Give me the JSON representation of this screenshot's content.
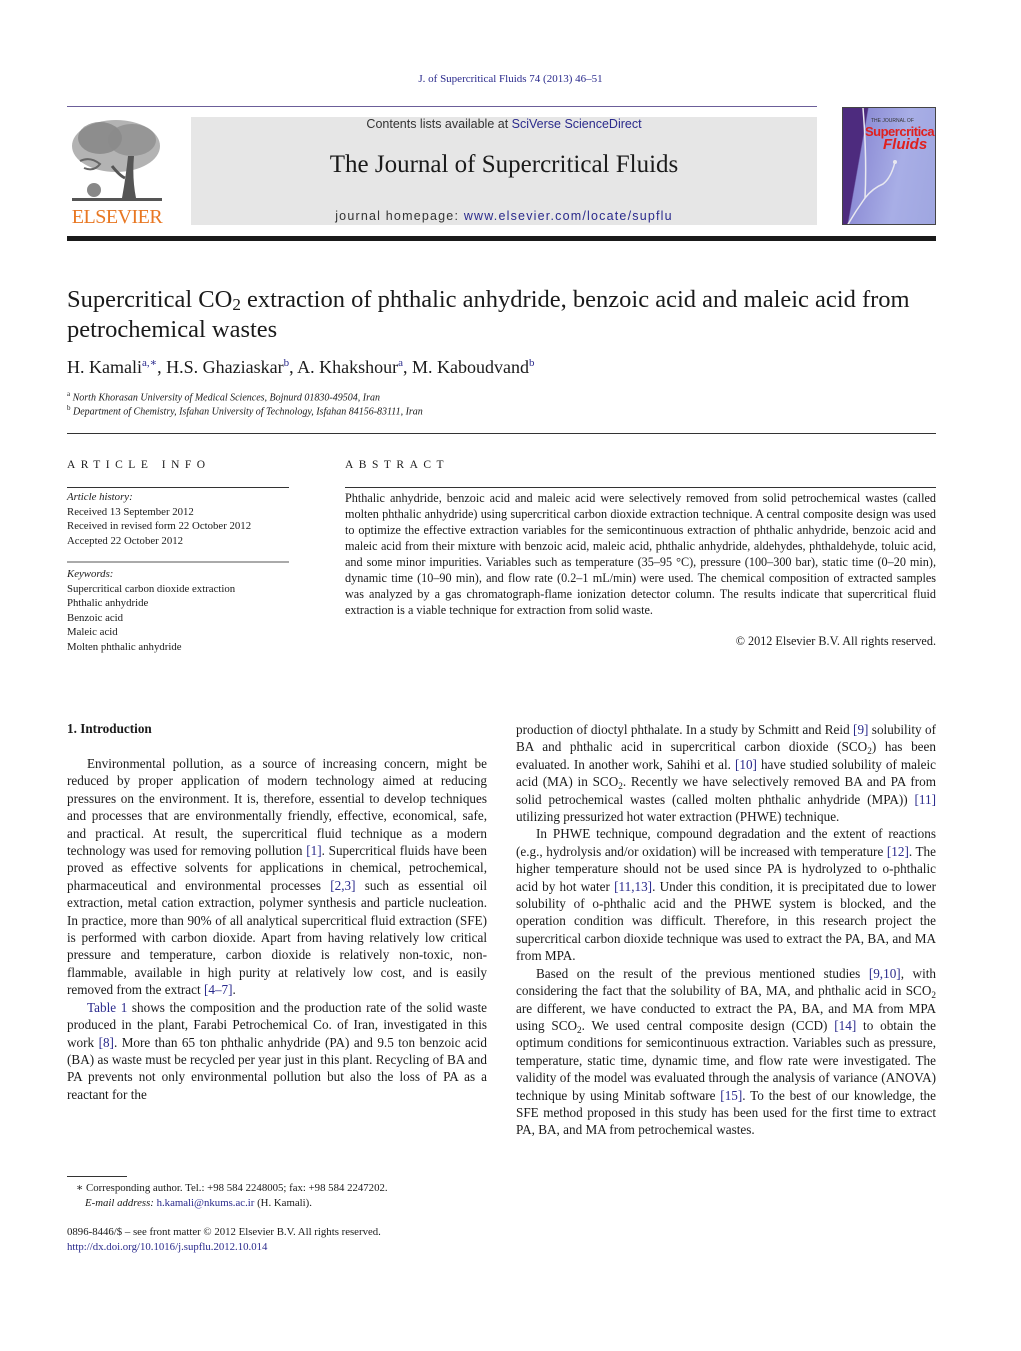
{
  "running_head": "J. of Supercritical Fluids 74 (2013) 46–51",
  "publisher": {
    "logo_text": "ELSEVIER",
    "contents_prefix": "Contents lists available at ",
    "contents_link": "SciVerse ScienceDirect",
    "journal_title": "The Journal of Supercritical Fluids",
    "homepage_prefix": "journal homepage: ",
    "homepage_link": "www.elsevier.com/locate/supflu",
    "cover": {
      "small_text": "THE JOURNAL OF",
      "title_line1": "Supercritical",
      "title_line2": "Fluids"
    },
    "colors": {
      "elsevier_orange": "#e87722",
      "link_blue": "#2a2a8c",
      "banner_gray": "#e6e6e6"
    }
  },
  "article": {
    "title_part1": "Supercritical CO",
    "title_sub": "2",
    "title_part2": " extraction of phthalic anhydride, benzoic acid and maleic acid from petrochemical wastes",
    "authors": [
      {
        "name": "H. Kamali",
        "sup": "a,∗"
      },
      {
        "name": "H.S. Ghaziaskar",
        "sup": "b"
      },
      {
        "name": "A. Khakshour",
        "sup": "a"
      },
      {
        "name": "M. Kaboudvand",
        "sup": "b"
      }
    ],
    "affiliations": [
      {
        "mark": "a",
        "text": "North Khorasan University of Medical Sciences, Bojnurd 01830-49504, Iran"
      },
      {
        "mark": "b",
        "text": "Department of Chemistry, Isfahan University of Technology, Isfahan 84156-83111, Iran"
      }
    ]
  },
  "article_info": {
    "heading": "ARTICLE INFO",
    "history_label": "Article history:",
    "history": [
      "Received 13 September 2012",
      "Received in revised form 22 October 2012",
      "Accepted 22 October 2012"
    ],
    "keywords_label": "Keywords:",
    "keywords": [
      "Supercritical carbon dioxide extraction",
      "Phthalic anhydride",
      "Benzoic acid",
      "Maleic acid",
      "Molten phthalic anhydride"
    ]
  },
  "abstract": {
    "heading": "ABSTRACT",
    "text": "Phthalic anhydride, benzoic acid and maleic acid were selectively removed from solid petrochemical wastes (called molten phthalic anhydride) using supercritical carbon dioxide extraction technique. A central composite design was used to optimize the effective extraction variables for the semicontin­uous extraction of phthalic anhydride, benzoic acid and maleic acid from their mixture with benzoic acid, maleic acid, phthalic anhydride, aldehydes, phthaldehyde, toluic acid, and some minor impuri­ties. Variables such as temperature (35–95 °C), pressure (100–300 bar), static time (0–20 min), dynamic time (10–90 min), and flow rate (0.2–1 mL/min) were used. The chemical composition of extracted sam­ples was analyzed by a gas chromatograph-flame ionization detector column. The results indicate that supercritical fluid extraction is a viable technique for extraction from solid waste.",
    "copyright": "© 2012 Elsevier B.V. All rights reserved."
  },
  "body": {
    "section_heading": "1.  Introduction",
    "left_p1": [
      {
        "t": "Environmental pollution, as a source of increasing concern, might be reduced by proper application of modern technology aimed at reducing pressures on the environment. It is, therefore, essential to develop techniques and processes that are environ­mentally friendly, effective, economical, safe, and practical. At result, the supercritical fluid technique as a modern technology was used for removing pollution "
      },
      {
        "ref": "[1]"
      },
      {
        "t": ". Supercritical fluids have been proved as effective solvents for applications in chemical, petro­chemical, pharmaceutical and environmental processes "
      },
      {
        "ref": "[2,3]"
      },
      {
        "t": " such as essential oil extraction, metal cation extraction, polymer syn­thesis and particle nucleation. In practice, more than 90% of all analytical supercritical fluid extraction (SFE) is performed with carbon dioxide. Apart from having relatively low critical pressure and temperature, carbon dioxide is relatively non-toxic, non-flammable, available in high purity at relatively low cost, and is easily removed from the extract "
      },
      {
        "ref": "[4–7]"
      },
      {
        "t": "."
      }
    ],
    "left_p2": [
      {
        "ref": "Table 1"
      },
      {
        "t": " shows the composition and the production rate of the solid waste produced in the plant, Farabi Petrochemical Co. of Iran, investigated in this work "
      },
      {
        "ref": "[8]"
      },
      {
        "t": ". More than 65 ton phthalic anhydride (PA) and 9.5 ton benzoic acid (BA) as waste must be recycled per year just in this plant. Recycling of BA and PA prevents not only environmental pollution but also the loss of PA as a reactant for the"
      }
    ],
    "right_p1": [
      {
        "t": "production of dioctyl phthalate. In a study by Schmitt and Reid "
      },
      {
        "ref": "[9]"
      },
      {
        "t": " solubility of BA and phthalic acid in supercritical carbon dioxide (SCO"
      },
      {
        "sub": "2"
      },
      {
        "t": ") has been evaluated. In another work, Sahihi et al. "
      },
      {
        "ref": "[10]"
      },
      {
        "t": " have studied solubility of maleic acid (MA) in SCO"
      },
      {
        "sub": "2"
      },
      {
        "t": ". Recently we have selectively removed BA and PA from solid petrochemical wastes (called molten phthalic anhydride (MPA)) "
      },
      {
        "ref": "[11]"
      },
      {
        "t": " utilizing pressurized hot water extraction (PHWE) technique."
      }
    ],
    "right_p2": [
      {
        "t": "In PHWE technique, compound degradation and the extent of reactions (e.g., hydrolysis and/or oxidation) will be increased with temperature "
      },
      {
        "ref": "[12]"
      },
      {
        "t": ". The higher temperature should not be used since PA is hydrolyzed to o-phthalic acid by hot water "
      },
      {
        "ref": "[11,13]"
      },
      {
        "t": ". Under this condition, it is precipitated due to lower solubility of o-phthalic acid and the PHWE system is blocked, and the operation condition was difficult. Therefore, in this research project the supercritical carbon dioxide technique was used to extract the PA, BA, and MA from MPA."
      }
    ],
    "right_p3": [
      {
        "t": "Based on the result of the previous mentioned studies "
      },
      {
        "ref": "[9,10]"
      },
      {
        "t": ", with considering the fact that the solubility of BA, MA, and phthalic acid in SCO"
      },
      {
        "sub": "2"
      },
      {
        "t": " are different, we have conducted to extract the PA, BA, and MA from MPA using SCO"
      },
      {
        "sub": "2"
      },
      {
        "t": ". We used central composite design (CCD) "
      },
      {
        "ref": "[14]"
      },
      {
        "t": " to obtain the optimum conditions for semicon­tinuous extraction. Variables such as pressure, temperature, static time, dynamic time, and flow rate were investigated. The valid­ity of the model was evaluated through the analysis of variance (ANOVA) technique by using Minitab software "
      },
      {
        "ref": "[15]"
      },
      {
        "t": ". To the best of our knowledge, the SFE method proposed in this study has been used for the first time to extract PA, BA, and MA from petrochemical wastes."
      }
    ]
  },
  "footnote": {
    "mark": "∗",
    "corresponding": "Corresponding author. Tel.: +98 584 2248005; fax: +98 584 2247202.",
    "email_label": "E-mail address:",
    "email": "h.kamali@nkums.ac.ir",
    "email_suffix": " (H. Kamali)."
  },
  "front_matter": {
    "issn_line": "0896-8446/$ – see front matter © 2012 Elsevier B.V. All rights reserved.",
    "doi": "http://dx.doi.org/10.1016/j.supflu.2012.10.014"
  }
}
